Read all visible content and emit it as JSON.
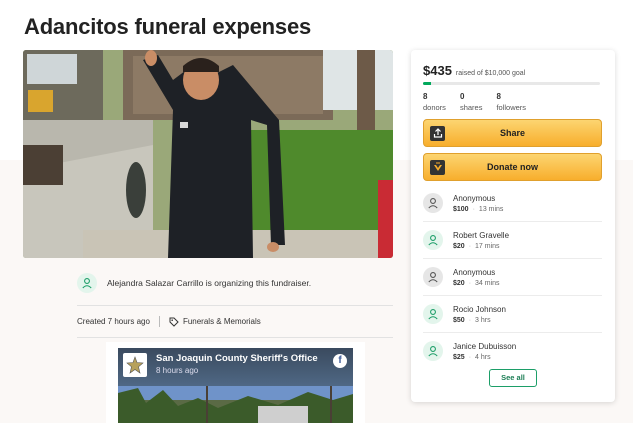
{
  "page": {
    "title": "Adancitos funeral expenses"
  },
  "organizer": {
    "text": "Alejandra Salazar Carrillo is organizing this fundraiser."
  },
  "meta": {
    "created": "Created 7 hours ago",
    "category": "Funerals & Memorials",
    "category_icon": "tag-icon"
  },
  "embed": {
    "title": "San Joaquin County Sheriff's Office",
    "time": "8 hours ago",
    "fb_glyph": "f"
  },
  "donation_card": {
    "raised": "$435",
    "goal_text": "raised of $10,000 goal",
    "progress_fraction": 0.0435,
    "stats": [
      {
        "number": "8",
        "label": "donors"
      },
      {
        "number": "0",
        "label": "shares"
      },
      {
        "number": "8",
        "label": "followers"
      }
    ],
    "share_label": "Share",
    "donate_label": "Donate now",
    "see_all_label": "See all",
    "colors": {
      "progress": "#02a95c",
      "button_top": "#fcd571",
      "button_bottom": "#f8ae2c",
      "avatar_green": "#e3f5ec",
      "avatar_gray": "#e6e6e6"
    }
  },
  "donations": [
    {
      "name": "Anonymous",
      "amount": "$100",
      "time": "13 mins",
      "avatar": "gray"
    },
    {
      "name": "Robert Gravelle",
      "amount": "$20",
      "time": "17 mins",
      "avatar": "green"
    },
    {
      "name": "Anonymous",
      "amount": "$20",
      "time": "34 mins",
      "avatar": "gray"
    },
    {
      "name": "Rocio Johnson",
      "amount": "$50",
      "time": "3 hrs",
      "avatar": "green"
    },
    {
      "name": "Janice Dubuisson",
      "amount": "$25",
      "time": "4 hrs",
      "avatar": "green"
    }
  ]
}
